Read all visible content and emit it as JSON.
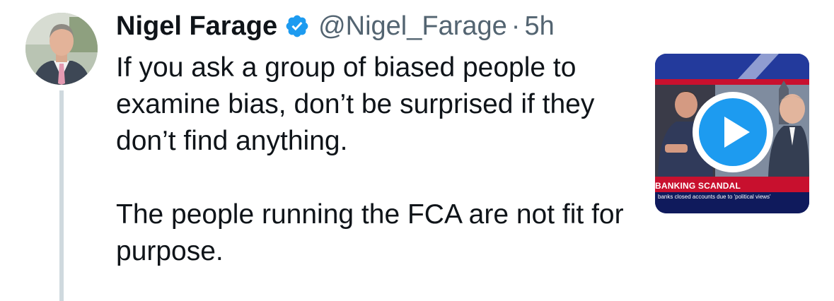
{
  "author": {
    "display_name": "Nigel Farage",
    "handle": "@Nigel_Farage",
    "separator": "·",
    "time": "5h",
    "verified": true
  },
  "tweet": {
    "paragraphs": [
      "If you ask a group of biased people to examine bias, don’t be surprised if they don’t find anything.",
      "The people running the FCA are not fit for purpose."
    ]
  },
  "media": {
    "type": "video",
    "chyron_title": "BANKING SCANDAL",
    "chyron_subtitle": "banks closed accounts due to 'political views'"
  },
  "colors": {
    "text": "#0f1419",
    "secondary": "#536471",
    "verified_blue": "#1d9bf0",
    "play_blue": "#1d9bf0",
    "thread_line": "#cfd9de"
  },
  "icons": {
    "verified": "verified-badge-icon",
    "play": "play-icon"
  }
}
